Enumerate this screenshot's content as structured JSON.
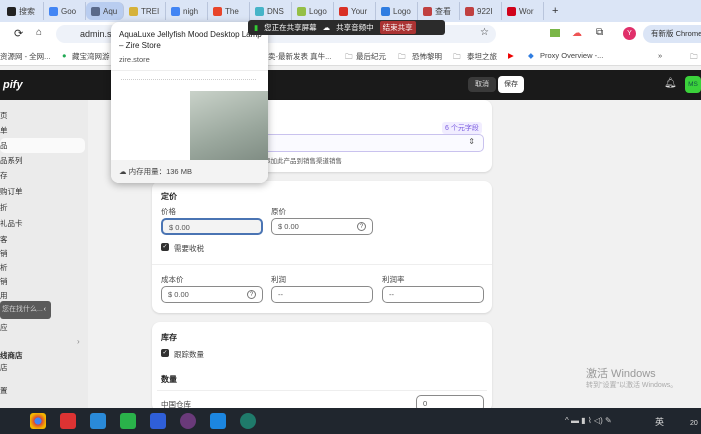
{
  "browser": {
    "tabs": [
      {
        "label": "搜索",
        "color": "#222"
      },
      {
        "label": "Goo",
        "color": "#4285f4"
      },
      {
        "label": "Aqu",
        "color": "#5a6a8a",
        "active": true
      },
      {
        "label": "TREI",
        "color": "#d6b23a"
      },
      {
        "label": "nigh",
        "color": "#4285f4"
      },
      {
        "label": "The",
        "color": "#e8452b"
      },
      {
        "label": "DNS",
        "color": "#46b4c8"
      },
      {
        "label": "Logo",
        "color": "#95bf47"
      },
      {
        "label": "Your",
        "color": "#d93025"
      },
      {
        "label": "Logo",
        "color": "#2f7de1"
      },
      {
        "label": "查看",
        "color": "#c04040"
      },
      {
        "label": "922I",
        "color": "#c04040"
      },
      {
        "label": "Wor",
        "color": "#d0021b"
      }
    ],
    "new_tab": "+",
    "url": "admin.sh",
    "update_button": "有新版 Chrome",
    "profile_initial": "Y",
    "bookmarks": [
      "资源网 - 全网...",
      "藏宝湾网游",
      "卖-最新发表 真牛...",
      "最后纪元",
      "恐怖黎明",
      "泰坦之旅",
      "Proxy Overview -..."
    ],
    "more_bookmarks": "»"
  },
  "tab_preview": {
    "title": "AquaLuxe Jellyfish Mood Desktop Lamp – Zire Store",
    "domain": "zire.store",
    "memory": "内存用量：136 MB"
  },
  "screen_share": {
    "status": "您正在共享屏幕",
    "audio": "共享音频中",
    "stop": "结束共享"
  },
  "app": {
    "logo": "pify",
    "cancel": "取消",
    "save": "保存",
    "avatar": "MS"
  },
  "sidebar": {
    "items": [
      "页",
      "单",
      "品",
      "品系列",
      "存",
      "购订单",
      "折",
      "礼品卡",
      "客",
      "销",
      "析",
      "销",
      "用",
      "应",
      "线商店",
      "店",
      "置"
    ],
    "search_tooltip": "您在找什么..."
  },
  "metafields": {
    "count": "6 个元字段",
    "hint": "添加此产品到销售渠道销售"
  },
  "pricing": {
    "title": "定价",
    "price_label": "价格",
    "price_value": "$ 0.00",
    "compare_label": "原价",
    "compare_value": "$ 0.00",
    "tax_label": "需要收税",
    "cost_label": "成本价",
    "cost_value": "$ 0.00",
    "profit_label": "利润",
    "profit_value": "--",
    "margin_label": "利润率",
    "margin_value": "--"
  },
  "inventory": {
    "title": "库存",
    "track_label": "跟踪数量",
    "qty_title": "数量",
    "location": "中国仓库",
    "qty_value": "0"
  },
  "watermark": {
    "title": "激活 Windows",
    "subtitle": "转到\"设置\"以激活 Windows。"
  },
  "taskbar": {
    "ime": "英",
    "clock": "20"
  }
}
